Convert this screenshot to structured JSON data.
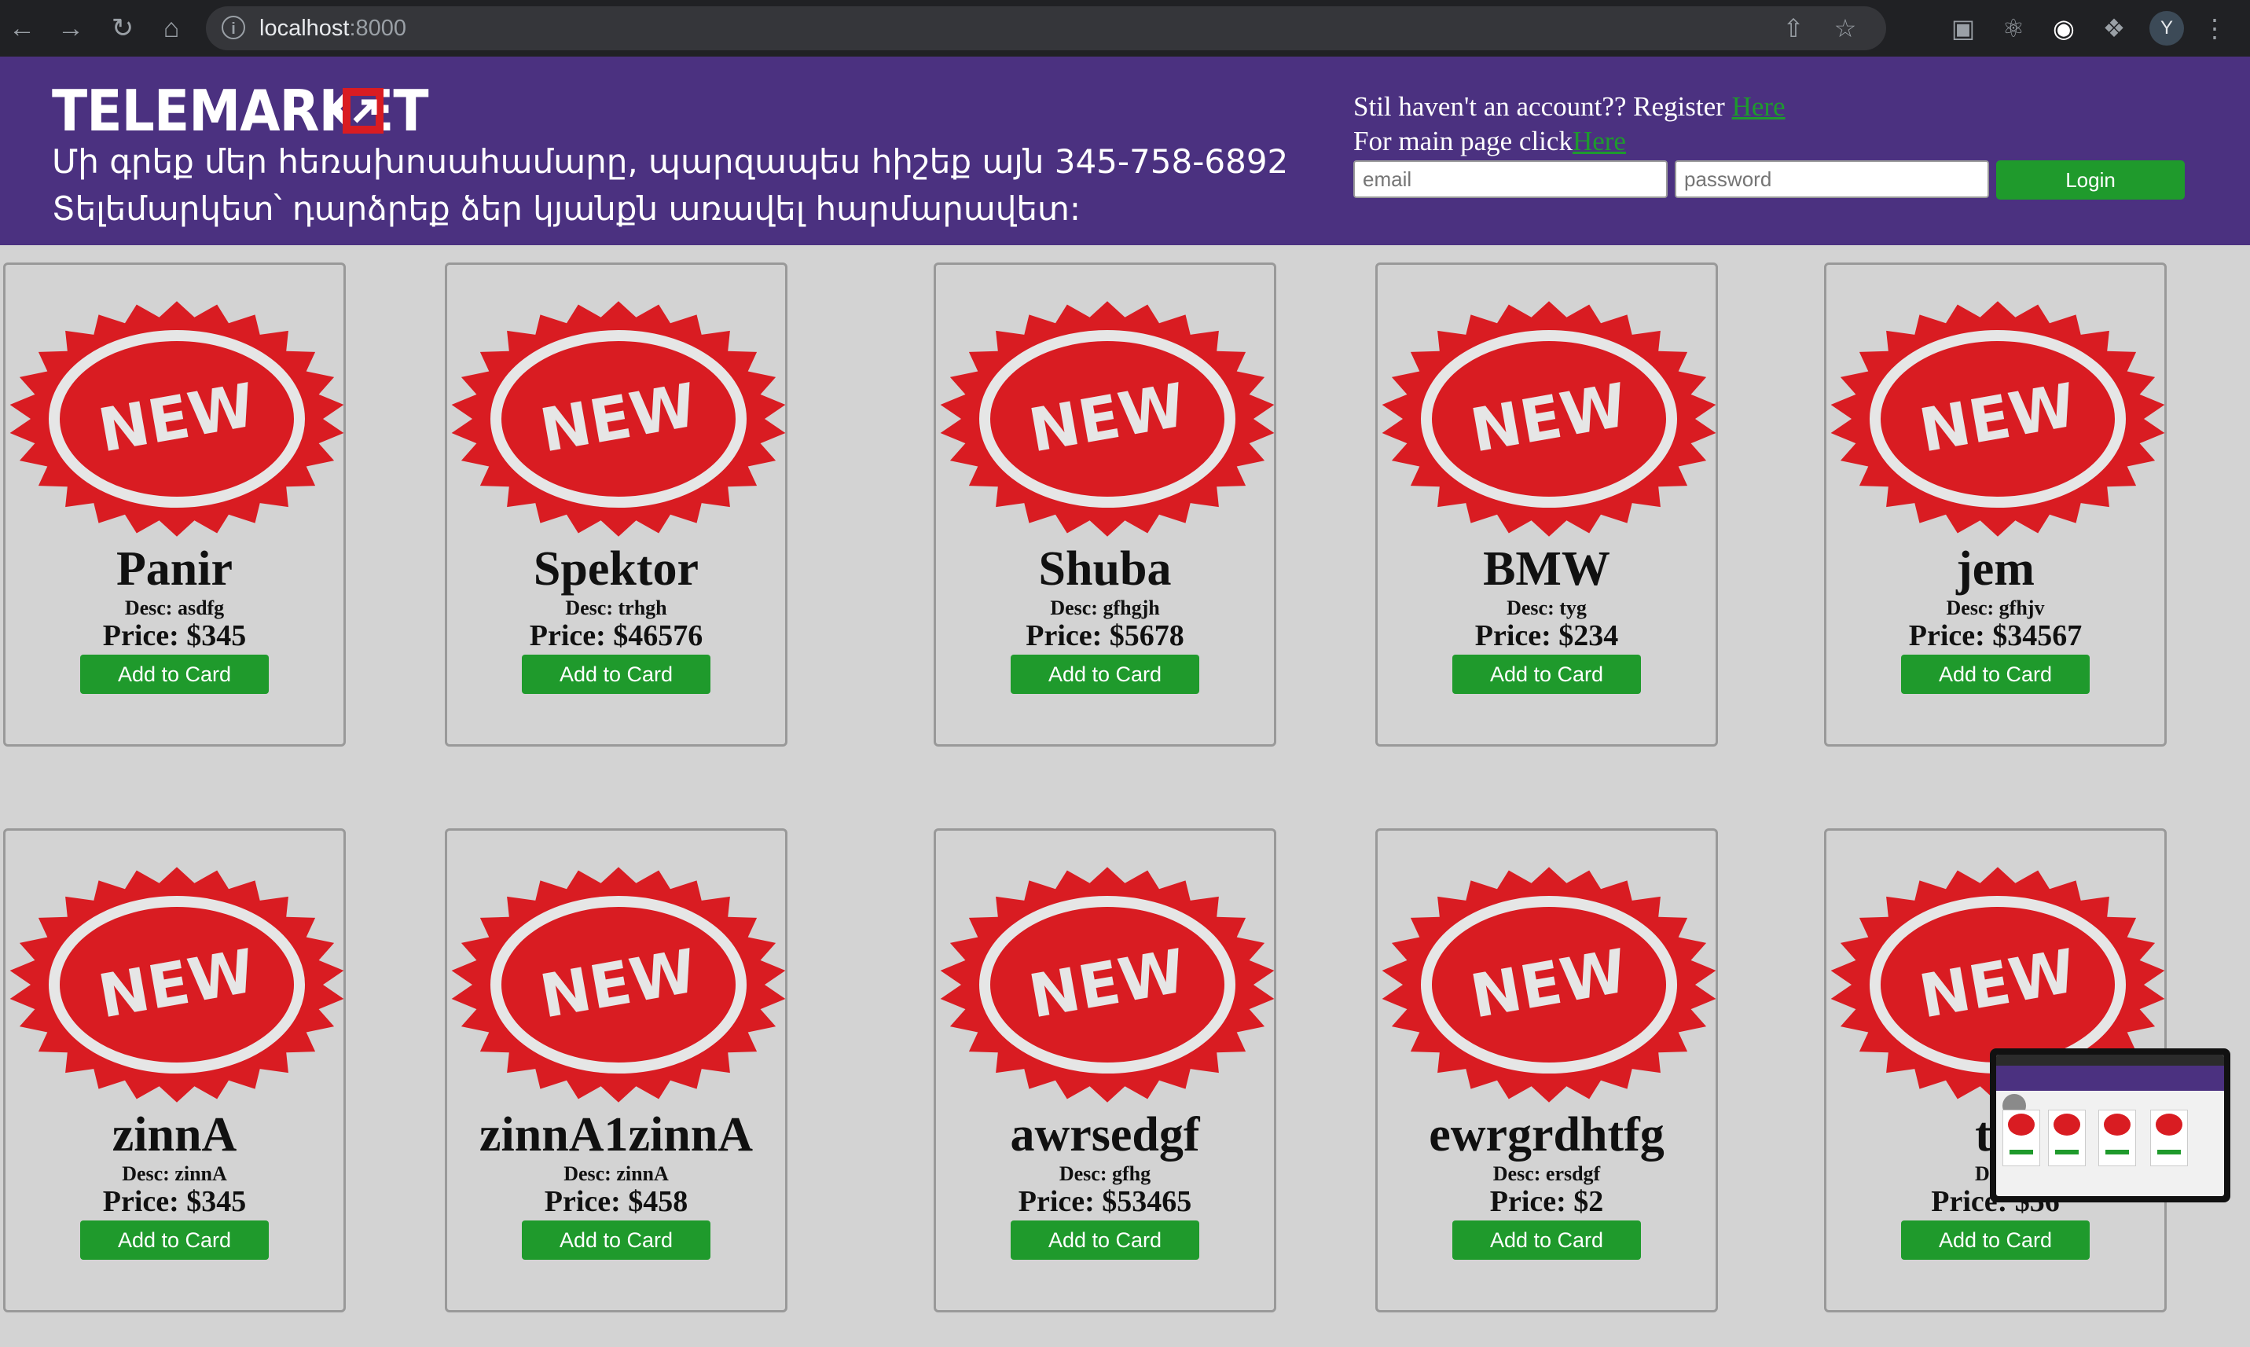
{
  "browser": {
    "url_host": "localhost",
    "url_port": ":8000",
    "profile_initial": "Y"
  },
  "header": {
    "logo_text": "TELEMARKET",
    "slogan_line1": "Մի գրեք մեր հեռախոսահամարը, պարզապես հիշեք այն 345-758-6892",
    "slogan_line2": "Տելեմարկետ՝ դարձրեք ձեր կյանքն առավել հարմարավետ:",
    "register_text": "Stil haven't an account?? Register ",
    "register_link": "Here",
    "main_page_text": "For main page click",
    "main_page_link": "Here",
    "email_placeholder": "email",
    "password_placeholder": "password",
    "login_label": "Login"
  },
  "badge_text": "NEW",
  "colors": {
    "header_bg": "#4b3180",
    "button_green": "#1f9a2c",
    "badge_red": "#d91c22",
    "link_green": "#1e9a2e"
  },
  "products": [
    {
      "name": "Panir",
      "desc": "Desc: asdfg",
      "price": "Price: $345",
      "button": "Add to Card"
    },
    {
      "name": "Spektor",
      "desc": "Desc: trhgh",
      "price": "Price: $46576",
      "button": "Add to Card"
    },
    {
      "name": "Shuba",
      "desc": "Desc: gfhgjh",
      "price": "Price: $5678",
      "button": "Add to Card"
    },
    {
      "name": "BMW",
      "desc": "Desc: tyg",
      "price": "Price: $234",
      "button": "Add to Card"
    },
    {
      "name": "jem",
      "desc": "Desc: gfhjv",
      "price": "Price: $34567",
      "button": "Add to Card"
    },
    {
      "name": "zinnA",
      "desc": "Desc: zinnA",
      "price": "Price: $345",
      "button": "Add to Card"
    },
    {
      "name": "zinnA1zinnA",
      "desc": "Desc: zinnA",
      "price": "Price: $458",
      "button": "Add to Card"
    },
    {
      "name": "awrsedgf",
      "desc": "Desc: gfhg",
      "price": "Price: $53465",
      "button": "Add to Card"
    },
    {
      "name": "ewrgrdhtfg",
      "desc": "Desc: ersdgf",
      "price": "Price: $2",
      "button": "Add to Card"
    },
    {
      "name": "ta",
      "desc": "Desc",
      "price": "Price: $56",
      "button": "Add to Card"
    }
  ]
}
